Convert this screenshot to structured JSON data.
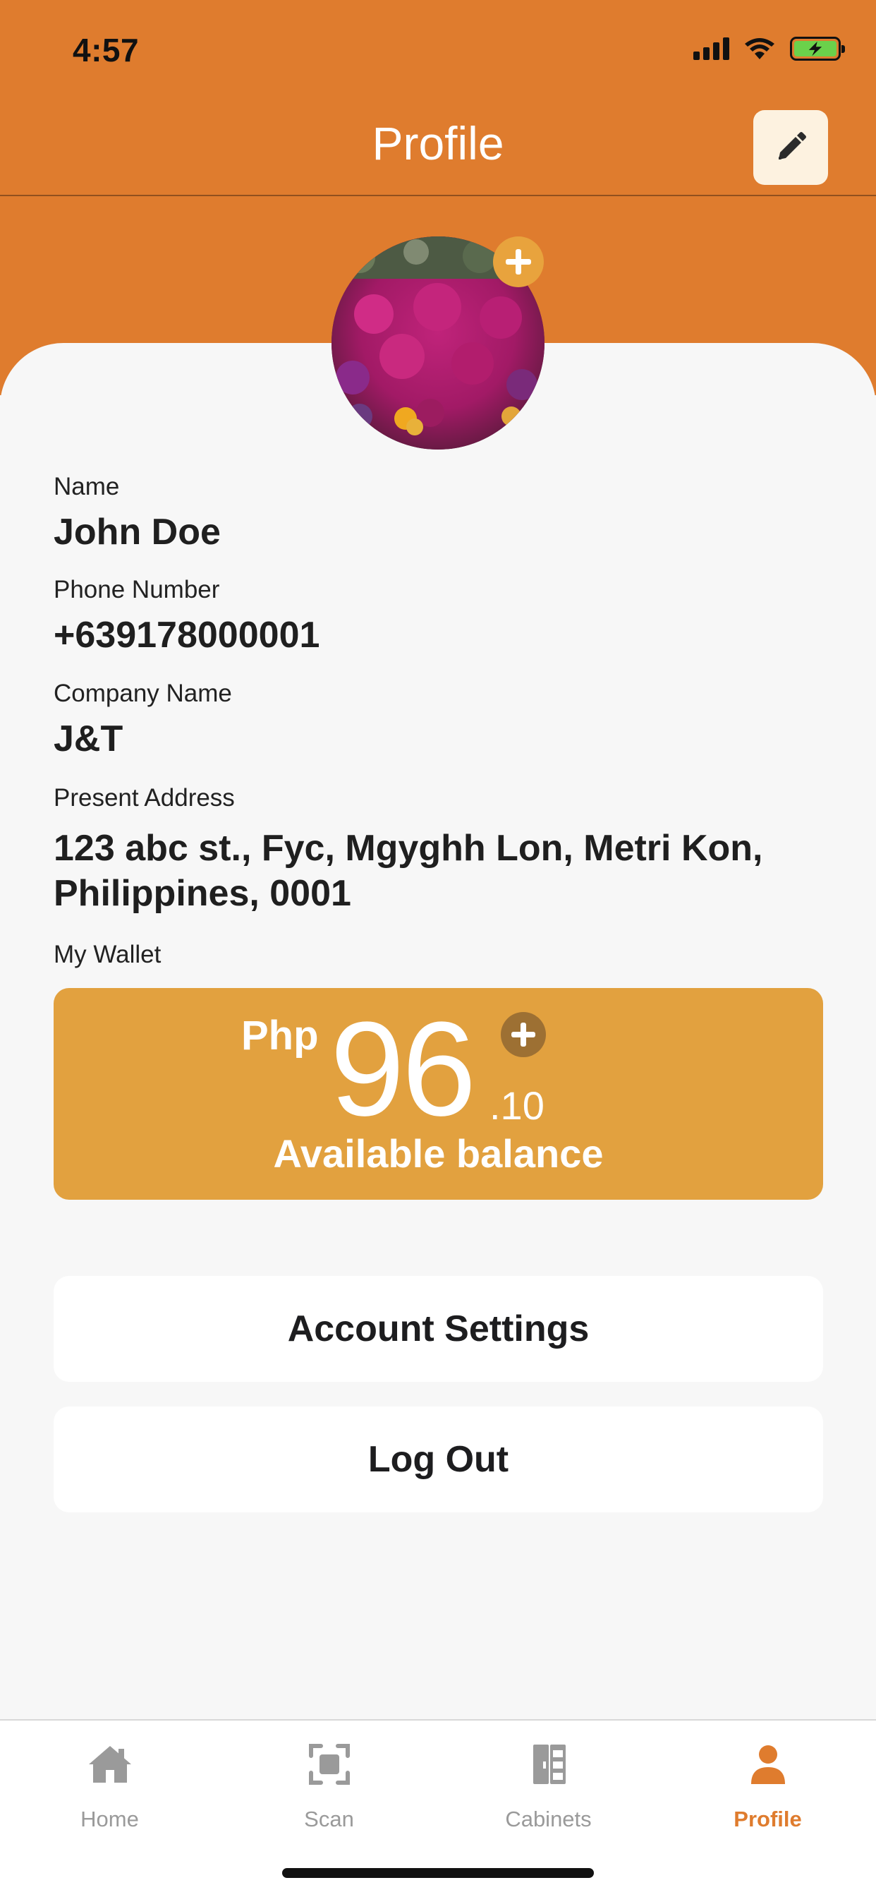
{
  "status_bar": {
    "time": "4:57"
  },
  "header": {
    "title": "Profile"
  },
  "profile": {
    "fields": [
      {
        "label": "Name",
        "value": "John Doe"
      },
      {
        "label": "Phone Number",
        "value": "+639178000001"
      },
      {
        "label": "Company Name",
        "value": "J&T"
      },
      {
        "label": "Present Address",
        "value": "123 abc st., Fyc, Mgyghh Lon, Metri Kon, Philippines, 0001"
      }
    ]
  },
  "wallet": {
    "label": "My Wallet",
    "currency": "Php",
    "whole": "96",
    "decimal": ".10",
    "caption": "Available balance"
  },
  "actions": {
    "account_settings": "Account Settings",
    "log_out": "Log Out"
  },
  "tab_bar": {
    "tabs": [
      {
        "label": "Home",
        "icon": "home-icon"
      },
      {
        "label": "Scan",
        "icon": "scan-icon"
      },
      {
        "label": "Cabinets",
        "icon": "cabinets-icon"
      },
      {
        "label": "Profile",
        "icon": "profile-icon"
      }
    ],
    "active": "Profile"
  },
  "colors": {
    "brand_orange": "#df7c2e",
    "wallet_gold": "#e2a13f",
    "inactive_tab": "#9a9a9a",
    "background": "#f7f7f7"
  }
}
